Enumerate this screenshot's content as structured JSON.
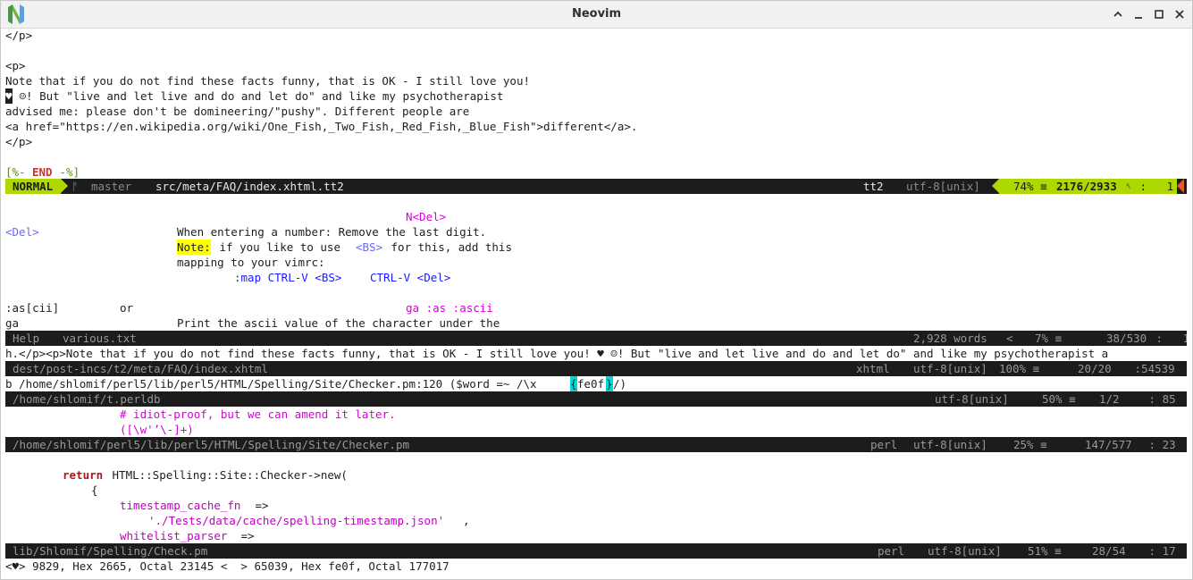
{
  "window": {
    "title": "Neovim"
  },
  "pane1": {
    "lines": [
      "</p>",
      "",
      "<p>",
      "Note that if you do not find these facts funny, that is OK - I still love you!",
      "♥",
      " ☺! But \"live and let live and do and let do\" and like my psychotherapist",
      "advised me: please don't be domineering/\"pushy\". Different people are",
      "<a href=\"https://en.wikipedia.org/wiki/One_Fish,_Two_Fish,_Red_Fish,_Blue_Fish\">different</a>.",
      "</p>",
      ""
    ],
    "end_open": "[%- ",
    "end_word": "END",
    "end_close": " -%]",
    "statusline": {
      "mode": "NORMAL",
      "branch_icon": "ᚠ",
      "branch": "master",
      "file": "src/meta/FAQ/index.xhtml.tt2",
      "filetype": "tt2",
      "encoding": "utf-8[unix]",
      "percent": "74% ≡",
      "position": "2176/2933",
      "ln_icon": "␤",
      "col": " :   1"
    }
  },
  "pane2": {
    "tag_ndel": "N<Del>",
    "key_del": "<Del>",
    "desc1": "When entering a number: Remove the last digit.",
    "note_label": "Note:",
    "note_text1": " if you like to use ",
    "key_bs": "<BS>",
    "note_text2": " for this, add this",
    "mapping_line": "mapping to your vimrc:",
    "map_cmd": ":map CTRL-V <BS>",
    "map_ctrlv": "CTRL-V <Del>",
    "ascii_cmd": ":as[cii]",
    "or_word": "or",
    "ascii_tags": "ga :as :ascii",
    "ga_key": "ga",
    "ascii_desc": "Print the ascii value of the character under the",
    "statusline": {
      "help": "Help",
      "file": "various.txt",
      "words": "2,928 words",
      "percent": "7% ≡",
      "position": "38/530",
      "col": " :   1"
    }
  },
  "pane3": {
    "line": "h.</p><p>Note that if you do not find these facts funny, that is OK - I still love you! ♥ ☺! But \"live and let live and do and let do\" and like my psychotherapist a",
    "statusline": {
      "file": "dest/post-incs/t2/meta/FAQ/index.xhtml",
      "filetype": "xhtml",
      "encoding": "utf-8[unix]",
      "percent": "100% ≡",
      "position": "20/20",
      "col": " :54539"
    }
  },
  "pane4": {
    "line_pre": "b /home/shlomif/perl5/lib/perl5/HTML/Spelling/Site/Checker.pm:120 ($word =~ /\\x",
    "brace_open": "{",
    "hex": "fe0f",
    "brace_close": "}",
    "line_post": "/)",
    "statusline": {
      "file": "/home/shlomif/t.perldb",
      "encoding": "utf-8[unix]",
      "percent": "50% ≡",
      "position": "1/2",
      "col": " : 85"
    }
  },
  "pane5": {
    "comment": "# idiot-proof, but we can amend it later.",
    "regex": "([\\w'’\\-]+)",
    "statusline": {
      "file": "/home/shlomif/perl5/lib/perl5/HTML/Spelling/Site/Checker.pm",
      "filetype": "perl",
      "encoding": "utf-8[unix]",
      "percent": "25% ≡",
      "position": "147/577",
      "col": " : 23"
    }
  },
  "pane6": {
    "return_kw": "return",
    "return_rest": " HTML::Spelling::Site::Checker->new(",
    "brace": "{",
    "key1": "timestamp_cache_fn",
    "arrow1": " =>",
    "value1": "'./Tests/data/cache/spelling-timestamp.json'",
    "comma": ",",
    "key2": "whitelist_parser",
    "arrow2": " =>",
    "statusline": {
      "file": "lib/Shlomif/Spelling/Check.pm",
      "filetype": "perl",
      "encoding": "utf-8[unix]",
      "percent": "51% ≡",
      "position": "28/54",
      "col": " : 17"
    }
  },
  "cmdline": {
    "text": "<♥> 9829, Hex 2665, Octal 23145 <  > 65039, Hex fe0f, Octal 177017"
  },
  "colors": {
    "statusline_bg": "#1c1c1c",
    "mode_bg": "#afd700",
    "percent_bg": "#afd700",
    "warning_accent": "#e05a2b"
  },
  "icons": {
    "logo": "neovim-logo",
    "window_controls": [
      "chevron-up-icon",
      "minimize-icon",
      "maximize-icon",
      "close-icon"
    ]
  }
}
